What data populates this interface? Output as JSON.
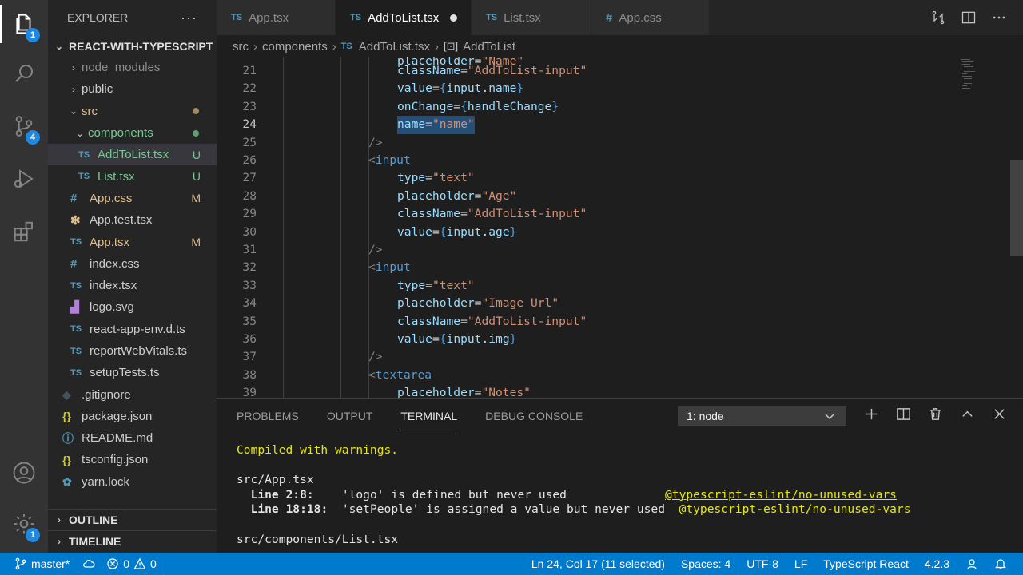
{
  "activity_bar": {
    "explorer_badge": "1",
    "scm_badge": "4",
    "settings_badge": "1"
  },
  "sidebar": {
    "title": "EXPLORER",
    "more": "···",
    "project": "REACT-WITH-TYPESCRIPT",
    "items": [
      {
        "label": "node_modules",
        "icon": "chevron-right",
        "status": ""
      },
      {
        "label": "public",
        "icon": "chevron-right",
        "status": ""
      },
      {
        "label": "src",
        "icon": "chevron-down",
        "status": "dot"
      },
      {
        "label": "components",
        "icon": "chevron-down",
        "status": "dot"
      },
      {
        "label": "AddToList.tsx",
        "icon": "TS",
        "status": "U"
      },
      {
        "label": "List.tsx",
        "icon": "TS",
        "status": "U"
      },
      {
        "label": "App.css",
        "icon": "#",
        "status": "M"
      },
      {
        "label": "App.test.tsx",
        "icon": "gear",
        "status": ""
      },
      {
        "label": "App.tsx",
        "icon": "TS",
        "status": "M"
      },
      {
        "label": "index.css",
        "icon": "#",
        "status": ""
      },
      {
        "label": "index.tsx",
        "icon": "TS",
        "status": ""
      },
      {
        "label": "logo.svg",
        "icon": "image",
        "status": ""
      },
      {
        "label": "react-app-env.d.ts",
        "icon": "TS",
        "status": ""
      },
      {
        "label": "reportWebVitals.ts",
        "icon": "TS",
        "status": ""
      },
      {
        "label": "setupTests.ts",
        "icon": "TS",
        "status": ""
      },
      {
        "label": ".gitignore",
        "icon": "git",
        "status": ""
      },
      {
        "label": "package.json",
        "icon": "{}",
        "status": ""
      },
      {
        "label": "README.md",
        "icon": "info",
        "status": ""
      },
      {
        "label": "tsconfig.json",
        "icon": "{}",
        "status": ""
      },
      {
        "label": "yarn.lock",
        "icon": "yarn",
        "status": ""
      }
    ],
    "outline": "OUTLINE",
    "timeline": "TIMELINE"
  },
  "tabs": [
    {
      "icon": "TS",
      "label": "App.tsx"
    },
    {
      "icon": "TS",
      "label": "AddToList.tsx"
    },
    {
      "icon": "TS",
      "label": "List.tsx"
    },
    {
      "icon": "#",
      "label": "App.css"
    }
  ],
  "breadcrumb": {
    "part1": "src",
    "part2": "components",
    "icon": "TS",
    "part3": "AddToList.tsx",
    "part4": "AddToList"
  },
  "editor": {
    "lines": [
      {
        "n": "21",
        "t": "className=\"AddToList-input\""
      },
      {
        "n": "22",
        "t": "value={input.name}"
      },
      {
        "n": "23",
        "t": "onChange={handleChange}"
      },
      {
        "n": "24",
        "t": "name=\"name\""
      },
      {
        "n": "25",
        "t": "/>"
      },
      {
        "n": "26",
        "t": "<input"
      },
      {
        "n": "27",
        "t": "type=\"text\""
      },
      {
        "n": "28",
        "t": "placeholder=\"Age\""
      },
      {
        "n": "29",
        "t": "className=\"AddToList-input\""
      },
      {
        "n": "30",
        "t": "value={input.age}"
      },
      {
        "n": "31",
        "t": "/>"
      },
      {
        "n": "32",
        "t": "<input"
      },
      {
        "n": "33",
        "t": "type=\"text\""
      },
      {
        "n": "34",
        "t": "placeholder=\"Image Url\""
      },
      {
        "n": "35",
        "t": "className=\"AddToList-input\""
      },
      {
        "n": "36",
        "t": "value={input.img}"
      },
      {
        "n": "37",
        "t": "/>"
      },
      {
        "n": "38",
        "t": "<textarea"
      },
      {
        "n": "39",
        "t": "placeholder=\"Notes\""
      }
    ]
  },
  "panel": {
    "tabs": [
      "PROBLEMS",
      "OUTPUT",
      "TERMINAL",
      "DEBUG CONSOLE"
    ],
    "terminal_select": "1: node",
    "terminal": {
      "compiled": "Compiled with warnings.",
      "file1": "src/App.tsx",
      "w1_loc": "Line 2:8:",
      "w1_msg": "'logo' is defined but never used",
      "w1_rule": "@typescript-eslint/no-unused-vars",
      "w2_loc": "Line 18:18:",
      "w2_msg": "'setPeople' is assigned a value but never used",
      "w2_rule": "@typescript-eslint/no-unused-vars",
      "file2": "src/components/List.tsx"
    }
  },
  "statusbar": {
    "branch": "master*",
    "errors": "0",
    "warnings": "0",
    "position": "Ln 24, Col 17 (11 selected)",
    "spaces": "Spaces: 4",
    "encoding": "UTF-8",
    "eol": "LF",
    "language": "TypeScript React",
    "version": "4.2.3"
  },
  "colors": {
    "accent": "#007acc",
    "ts": "#519aba",
    "untracked": "#73c991",
    "modified": "#e2c08d"
  }
}
